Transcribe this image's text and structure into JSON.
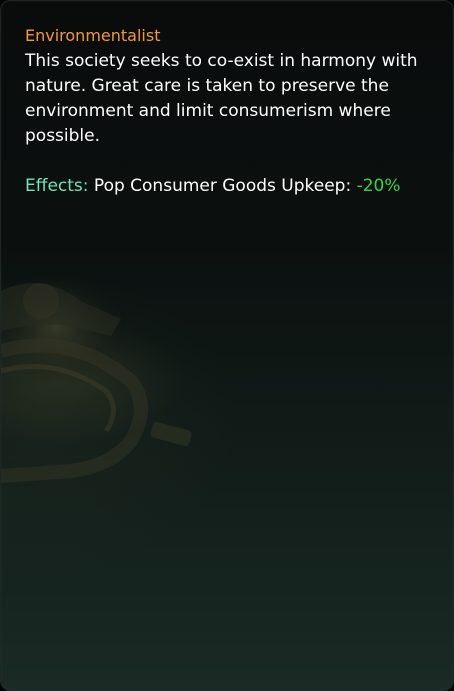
{
  "tooltip": {
    "title": "Environmentalist",
    "description": "This society seeks to co-exist in harmony with nature. Great care is taken to preserve the environment and limit consumerism where possible.",
    "effects_label": "Effects:",
    "effect_name": "Pop Consumer Goods Upkeep:",
    "effect_value": "-20%"
  },
  "colors": {
    "title": "#f39a2a",
    "effects_label": "#6ee6bf",
    "effect_value_positive": "#32d64a",
    "text": "#ffffff"
  },
  "icons": {
    "background_art": "faded-machinery-art"
  }
}
